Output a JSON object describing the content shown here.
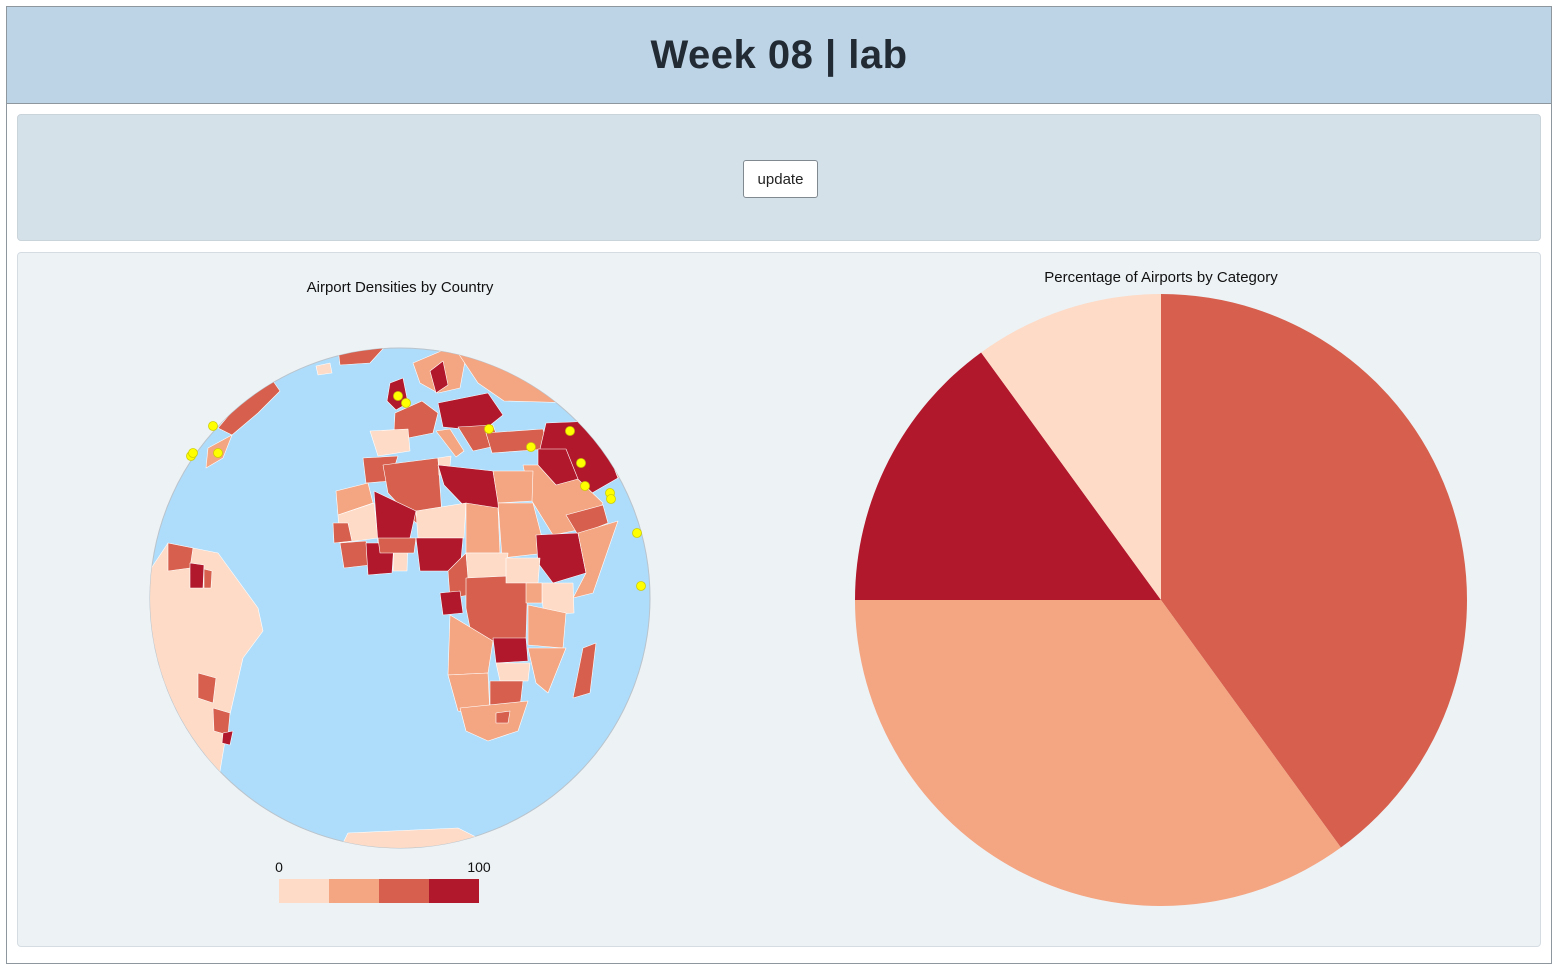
{
  "header": {
    "title": "Week 08 | lab"
  },
  "controls": {
    "update_label": "update"
  },
  "colors": {
    "header_bg": "#bdd4e7",
    "controls_bg": "#d5e1e9",
    "charts_bg": "#edf2f5",
    "ocean": "#aedcfb",
    "airport_marker": "#ffff00",
    "scale": [
      "#fddbc7",
      "#f4a582",
      "#d6604d",
      "#b2182b"
    ]
  },
  "chart_data": [
    {
      "type": "map",
      "title": "Airport Densities by Country",
      "projection": "orthographic",
      "color_legend": {
        "min_label": "0",
        "max_label": "100",
        "bins": 4
      }
    },
    {
      "type": "pie",
      "title": "Percentage of Airports by Category",
      "slices": [
        {
          "value": 40,
          "color": "#d6604d"
        },
        {
          "value": 35,
          "color": "#f4a582"
        },
        {
          "value": 15,
          "color": "#b2182b"
        },
        {
          "value": 10,
          "color": "#fddbc7"
        }
      ]
    }
  ]
}
